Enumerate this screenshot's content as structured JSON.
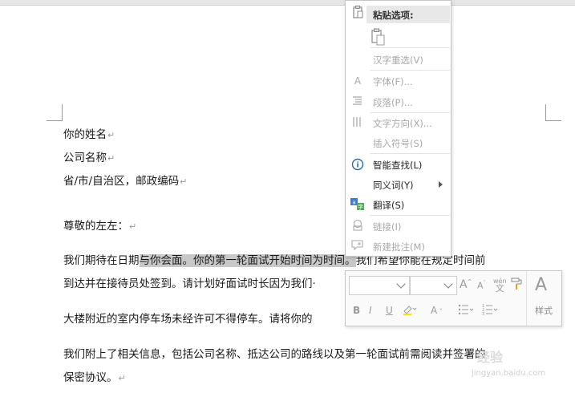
{
  "document": {
    "lines": [
      {
        "text": "你的姓名",
        "mark": "↵"
      },
      {
        "text": "公司名称",
        "mark": "↵"
      },
      {
        "text": "省/市/自治区，邮政编码",
        "mark": "↵"
      },
      {
        "text": "尊敬的左左：",
        "mark": "↵"
      }
    ],
    "para1_pre": "我们期待在日期",
    "para1_sel": "与你会面。你的第一轮面试开始时间为时间。",
    "para1_post": "我们希望你能在规定时间前",
    "para1_line2": "到达并在接待员处签到。请计划好面试时长因为我们·",
    "para2": "大楼附近的室内停车场未经许可不得停车。请将你的",
    "para3": "我们附上了相关信息，包括公司名称、抵达公司的路线以及第一轮面试前需阅读并签署的",
    "para3_line2": "保密协议。",
    "para3_mark": "↵"
  },
  "context_menu": {
    "paste_options": "粘贴选项:",
    "items": [
      {
        "label": "汉字重选(V)",
        "icon": "",
        "disabled": true
      },
      {
        "label": "字体(F)...",
        "icon": "font-icon",
        "disabled": true
      },
      {
        "label": "段落(P)...",
        "icon": "paragraph-icon",
        "disabled": true
      },
      {
        "label": "文字方向(X)...",
        "icon": "text-direction-icon",
        "disabled": true
      },
      {
        "label": "插入符号(S)",
        "icon": "",
        "disabled": true
      },
      {
        "label": "智能查找(L)",
        "icon": "smart-lookup-icon",
        "disabled": false
      },
      {
        "label": "同义词(Y)",
        "icon": "",
        "disabled": false
      },
      {
        "label": "翻译(S)",
        "icon": "translate-icon",
        "disabled": false
      },
      {
        "label": "链接(I)",
        "icon": "link-icon",
        "disabled": true
      },
      {
        "label": "新建批注(M)",
        "icon": "comment-icon",
        "disabled": true
      }
    ]
  },
  "mini_toolbar": {
    "style_label": "样式",
    "wen_label": "wén"
  },
  "watermark": {
    "site": "jingyan.baidu.com",
    "cn": "经验"
  }
}
